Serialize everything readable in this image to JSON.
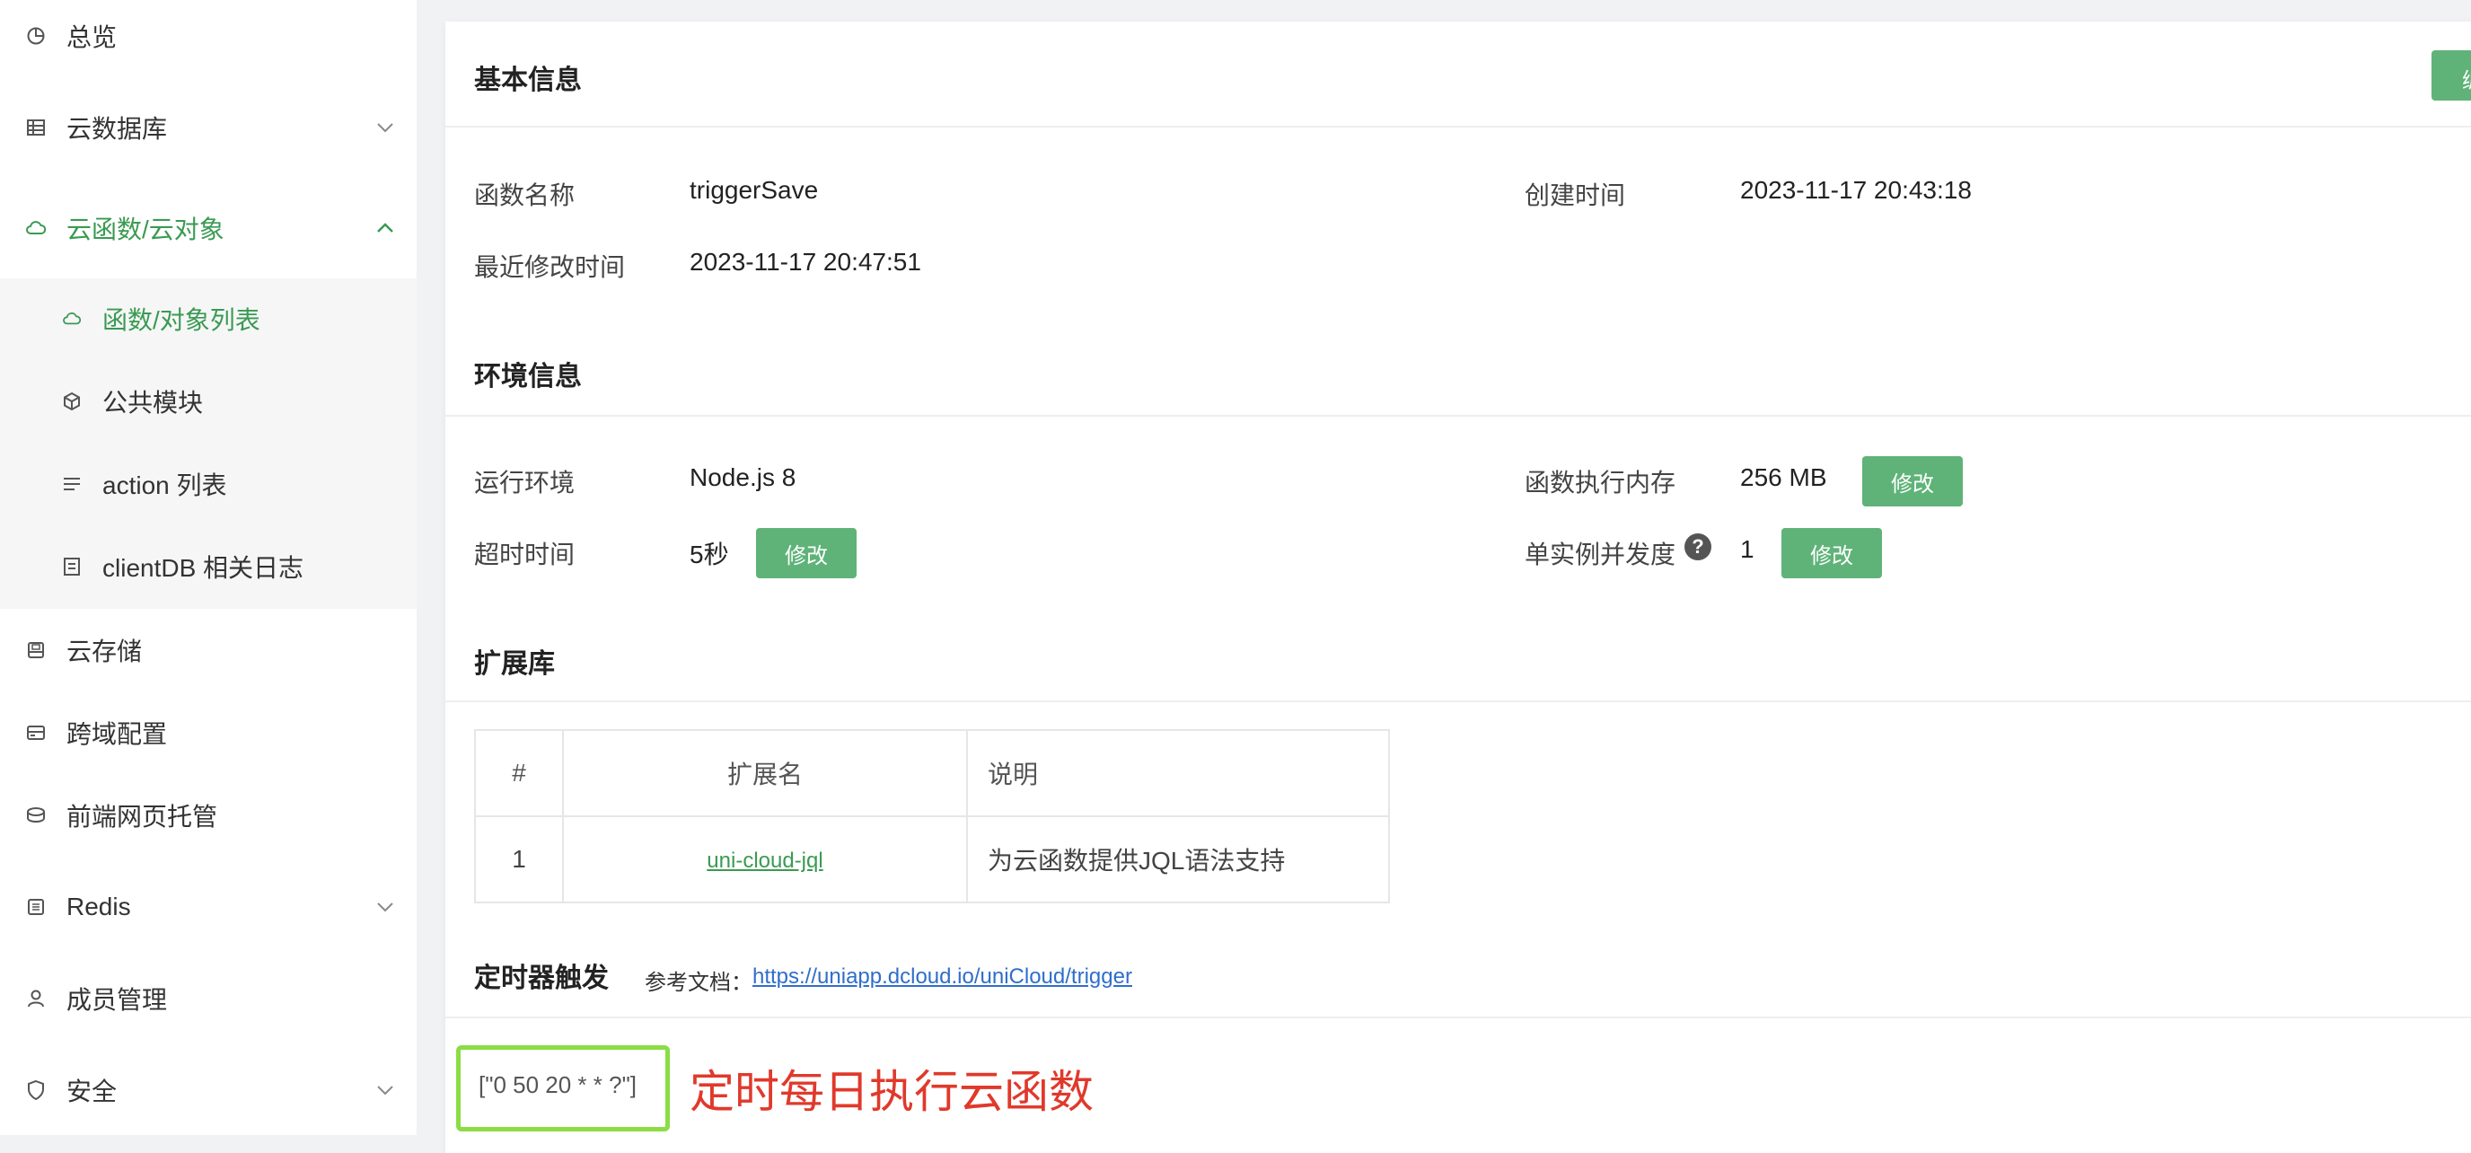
{
  "sidebar": {
    "items": [
      {
        "label": "总览",
        "icon": "pie-chart-icon"
      },
      {
        "label": "云数据库",
        "icon": "database-icon"
      },
      {
        "label": "云函数/云对象",
        "icon": "cloud-icon"
      },
      {
        "label": "云存储",
        "icon": "storage-icon"
      },
      {
        "label": "跨域配置",
        "icon": "card-icon"
      },
      {
        "label": "前端网页托管",
        "icon": "web-hosting-icon"
      },
      {
        "label": "Redis",
        "icon": "redis-icon"
      },
      {
        "label": "成员管理",
        "icon": "user-icon"
      },
      {
        "label": "安全",
        "icon": "shield-icon"
      }
    ],
    "submenu": [
      {
        "label": "函数/对象列表",
        "icon": "cloud-icon"
      },
      {
        "label": "公共模块",
        "icon": "cube-icon"
      },
      {
        "label": "action 列表",
        "icon": "list-icon"
      },
      {
        "label": "clientDB 相关日志",
        "icon": "log-icon"
      }
    ]
  },
  "basic": {
    "title": "基本信息",
    "func_name_label": "函数名称",
    "func_name": "triggerSave",
    "created_label": "创建时间",
    "created": "2023-11-17 20:43:18",
    "modified_label": "最近修改时间",
    "modified": "2023-11-17 20:47:51"
  },
  "env": {
    "title": "环境信息",
    "runtime_label": "运行环境",
    "runtime": "Node.js 8",
    "memory_label": "函数执行内存",
    "memory": "256 MB",
    "timeout_label": "超时时间",
    "timeout": "5秒",
    "concurrency_label": "单实例并发度",
    "concurrency": "1",
    "help": "?",
    "modify": "修改"
  },
  "ext": {
    "title": "扩展库",
    "headers": [
      "#",
      "扩展名",
      "说明"
    ],
    "rows": [
      {
        "idx": "1",
        "name": "uni-cloud-jql",
        "desc": "为云函数提供JQL语法支持"
      }
    ]
  },
  "timer": {
    "title": "定时器触发",
    "doc_label": "参考文档：",
    "doc_link": "https://uniapp.dcloud.io/uniCloud/trigger",
    "cron": "[\"0 50 20 * * ?\"]",
    "annotation": "定时每日执行云函数"
  },
  "colors": {
    "accent": "#3a9a52",
    "button": "#5fb378",
    "highlight_border": "#8bdc45",
    "annotation": "#e0392b",
    "link": "#2f6ecb"
  }
}
